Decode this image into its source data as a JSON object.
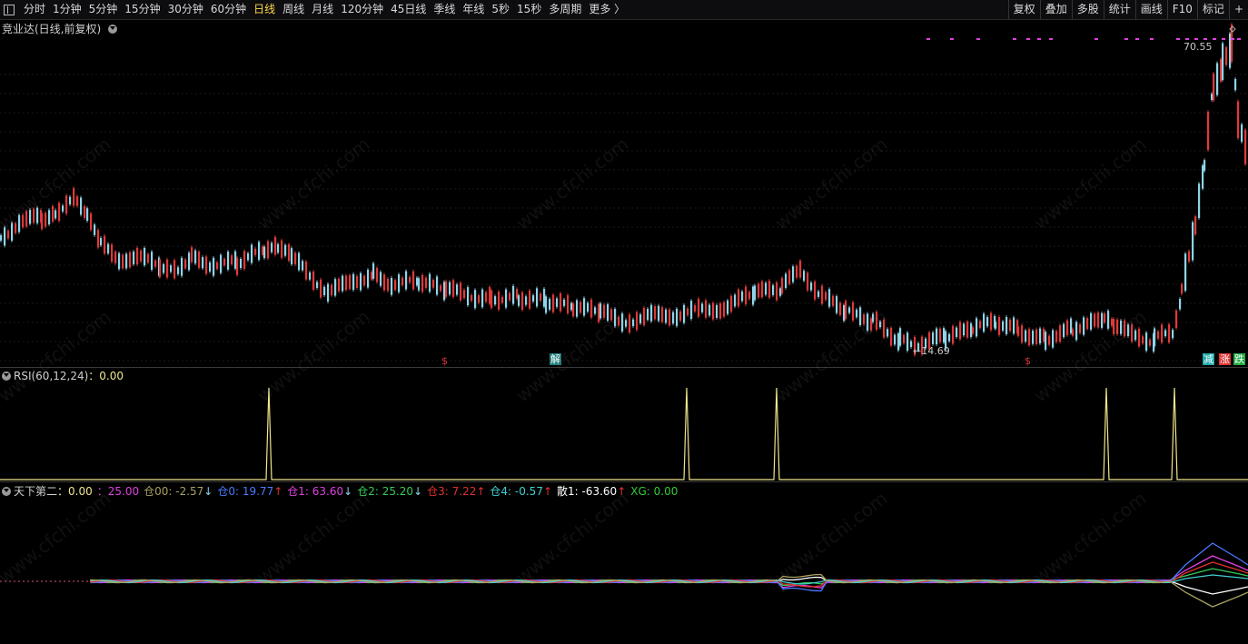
{
  "toolbar": {
    "timeframes": [
      "分时",
      "1分钟",
      "5分钟",
      "15分钟",
      "30分钟",
      "60分钟",
      "日线",
      "周线",
      "月线",
      "120分钟",
      "45日线",
      "季线",
      "年线",
      "5秒",
      "15秒",
      "多周期",
      "更多 〉"
    ],
    "active": "日线",
    "right_buttons": [
      "复权",
      "叠加",
      "多股",
      "统计",
      "画线",
      "F10",
      "标记",
      "+"
    ]
  },
  "main_panel": {
    "title": "竞业达(日线,前复权)",
    "high_label": "70.55",
    "low_label": "14.69",
    "signal_s1": "$",
    "signal_jie": "解",
    "signal_s2": "$",
    "tag_jian": "减",
    "tag_jian_color": "#1fa8a8",
    "tag_zhang": "涨",
    "tag_zhang_color": "#e03030",
    "tag_die": "跌",
    "tag_die_color": "#22aa44"
  },
  "rsi_panel": {
    "label": "RSI(60,12,24)",
    "value": "：0.00",
    "line_color": "#f0e68c"
  },
  "bottom_panel": {
    "name": "天下第二",
    "value": "：0.00",
    "items": [
      {
        "text": "：25.00",
        "color": "#e040e0",
        "arrow": ""
      },
      {
        "text": "仓00: -2.57",
        "color": "#a8a060",
        "arrow": "↓"
      },
      {
        "text": "仓0: 19.77",
        "color": "#4a7aff",
        "arrow": "↑"
      },
      {
        "text": "仓1: 63.60",
        "color": "#e040e0",
        "arrow": "↓"
      },
      {
        "text": "仓2: 25.20",
        "color": "#33cc55",
        "arrow": "↓"
      },
      {
        "text": "仓3: 7.22",
        "color": "#e03030",
        "arrow": "↑"
      },
      {
        "text": "仓4: -0.57",
        "color": "#40d0d0",
        "arrow": "↑"
      },
      {
        "text": "散1: -63.60",
        "color": "#ffffff",
        "arrow": "↑"
      },
      {
        "text": "XG: 0.00",
        "color": "#33cc33",
        "arrow": ""
      }
    ]
  },
  "watermark": "www.cfchi.com",
  "colors": {
    "up": "#e03a3a",
    "down": "#8fd4e8",
    "accent": "#ffd84a"
  }
}
